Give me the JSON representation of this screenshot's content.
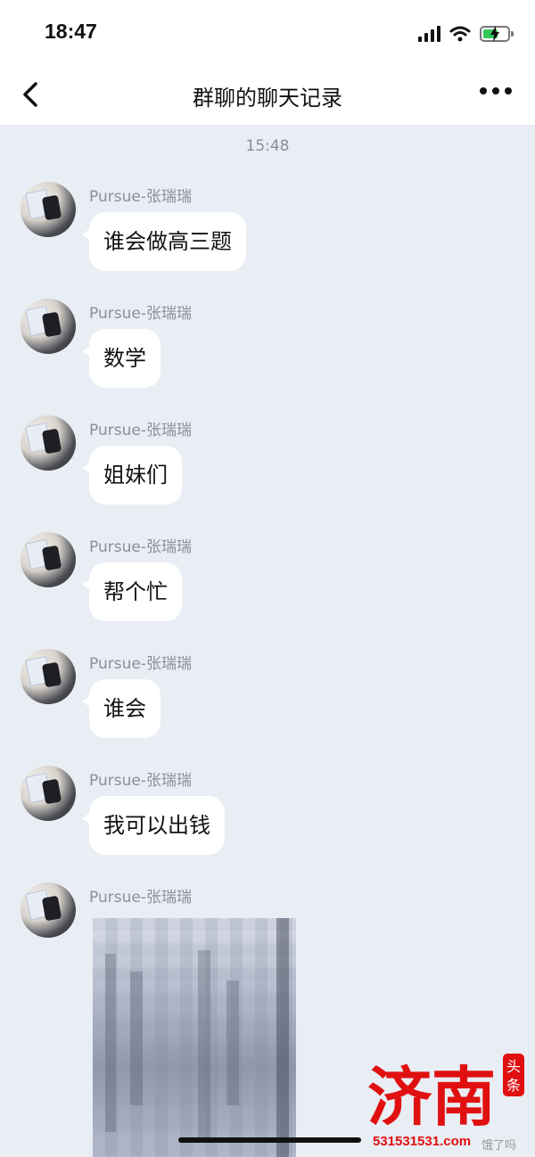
{
  "status_bar": {
    "time": "18:47"
  },
  "nav": {
    "title": "群聊的聊天记录"
  },
  "chat": {
    "time_divider": "15:48",
    "messages": [
      {
        "sender": "Pursue-张瑞瑞",
        "text": "谁会做高三题"
      },
      {
        "sender": "Pursue-张瑞瑞",
        "text": "数学"
      },
      {
        "sender": "Pursue-张瑞瑞",
        "text": "姐妹们"
      },
      {
        "sender": "Pursue-张瑞瑞",
        "text": "帮个忙"
      },
      {
        "sender": "Pursue-张瑞瑞",
        "text": "谁会"
      },
      {
        "sender": "Pursue-张瑞瑞",
        "text": "我可以出钱"
      },
      {
        "sender": "Pursue-张瑞瑞",
        "text": ""
      }
    ]
  },
  "watermark": {
    "logo_text": "济南",
    "logo_tag": "头条",
    "url": "531531531.com",
    "source": "饿了吗"
  },
  "colors": {
    "background": "#e9edf4",
    "bubble": "#ffffff",
    "meta_text": "#8a8f99",
    "watermark_red": "#e01010",
    "battery_green": "#34c759"
  }
}
